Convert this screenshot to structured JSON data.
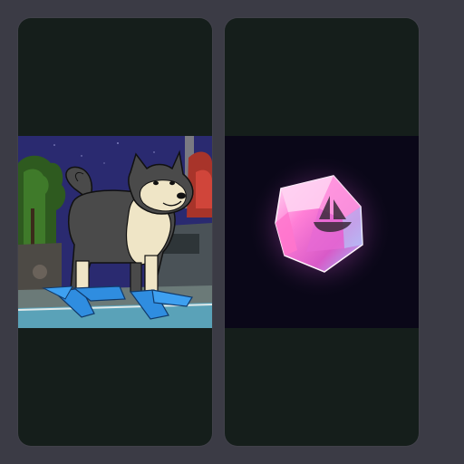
{
  "colors": {
    "page_background": "#3b3b45",
    "card_background": "#151e1b",
    "night_sky": "#2a2a70",
    "fin_blue": "#2f8de0",
    "gem_pink": "#ff6fd0",
    "gem_background": "#0a0718"
  },
  "cards": [
    {
      "kind": "nft-image",
      "icon": "dog-with-flippers-illustration"
    },
    {
      "kind": "nft-image",
      "icon": "glowing-pink-gem-with-ship-emblem"
    }
  ]
}
